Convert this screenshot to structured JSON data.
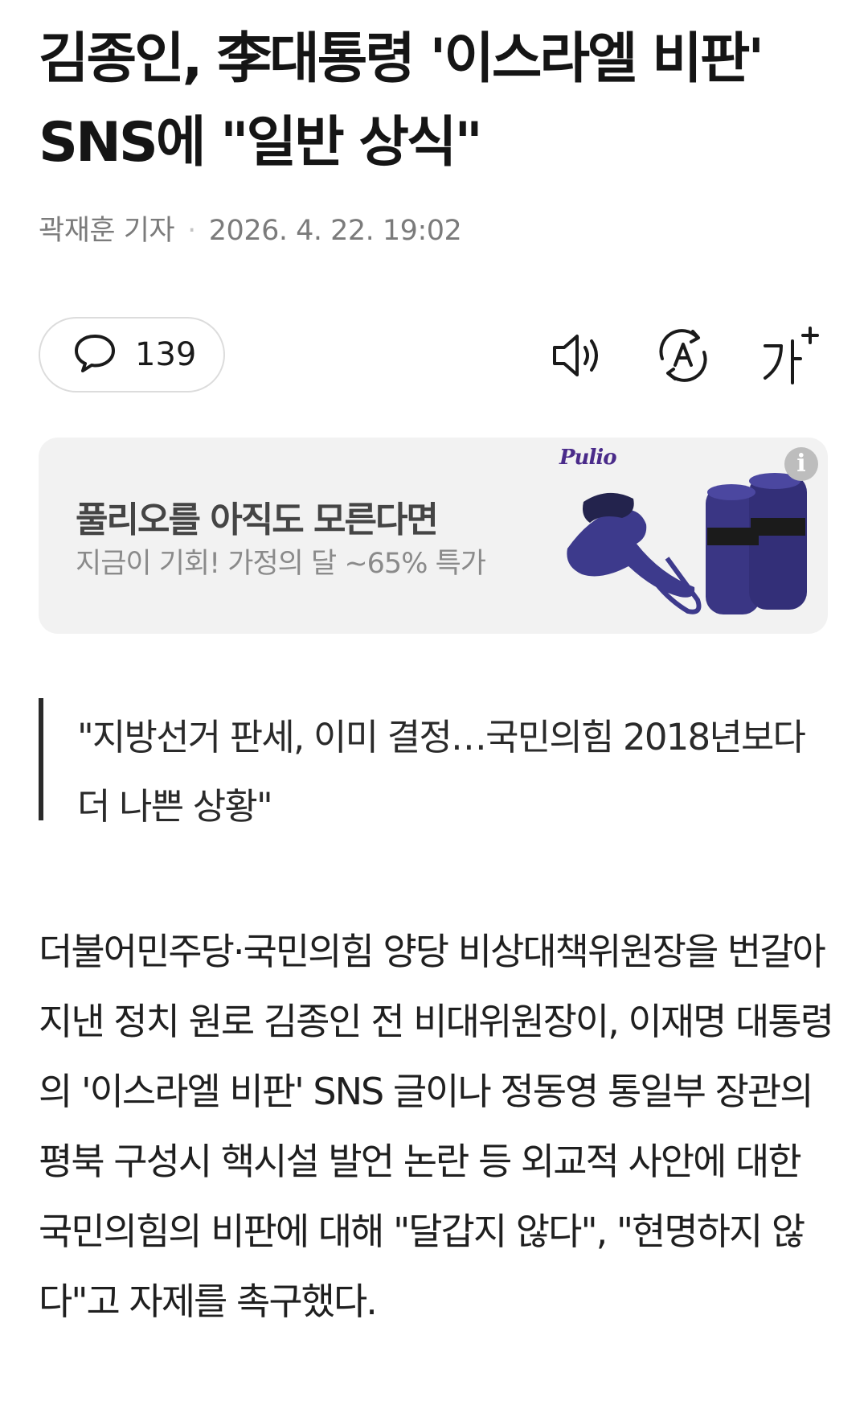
{
  "article": {
    "headline": "김종인, 李대통령 '이스라엘 비판' SNS에 \"일반 상식\"",
    "reporter": "곽재훈 기자",
    "datetime": "2026. 4. 22. 19:02",
    "subheadline": "\"지방선거 판세, 이미 결정…국민의힘 2018년보다 더 나쁜 상황\"",
    "body": "더불어민주당·국민의힘 양당 비상대책위원장을 번갈아 지낸 정치 원로 김종인 전 비대위원장이, 이재명 대통령의 '이스라엘 비판' SNS 글이나 정동영 통일부 장관의 평북 구성시 핵시설 발언 논란 등 외교적 사안에 대한 국민의힘의 비판에 대해 \"달갑지 않다\", \"현명하지 않다\"고 자제를 촉구했다."
  },
  "toolbar": {
    "comment_count": "139",
    "icons": [
      "comment-icon",
      "speaker-icon",
      "translate-icon",
      "font-size-icon"
    ]
  },
  "ad": {
    "title": "풀리오를 아직도 모른다면",
    "subtitle": "지금이 기회! 가정의 달 ~65% 특가",
    "brand": "Pulio",
    "info_glyph": "i"
  },
  "colors": {
    "headline": "#151515",
    "meta": "#7b7b7b",
    "ad_background": "#f2f2f2",
    "product_purple": "#3d3a8c"
  }
}
